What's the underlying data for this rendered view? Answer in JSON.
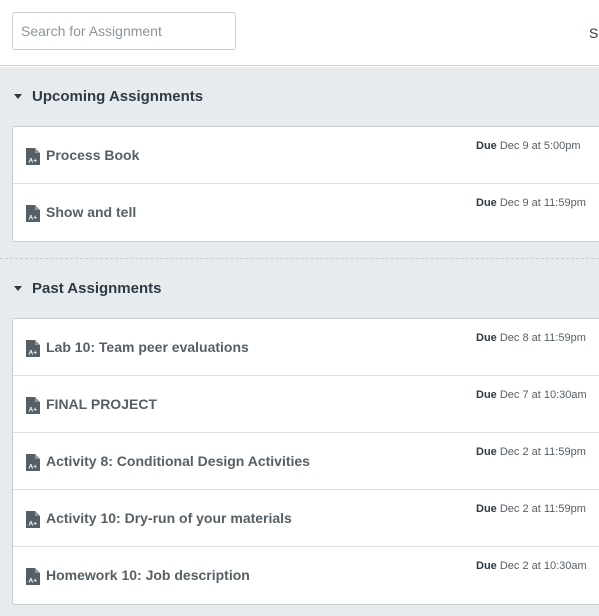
{
  "search": {
    "placeholder": "Search for Assignment",
    "value": ""
  },
  "top_right": {
    "text": "S"
  },
  "groups": [
    {
      "title": "Upcoming Assignments",
      "items": [
        {
          "title": "Process Book",
          "due_label": "Due",
          "due_date": "Dec 9 at 5:00pm"
        },
        {
          "title": "Show and tell",
          "due_label": "Due",
          "due_date": "Dec 9 at 11:59pm"
        }
      ]
    },
    {
      "title": "Past Assignments",
      "items": [
        {
          "title": "Lab 10: Team peer evaluations",
          "due_label": "Due",
          "due_date": "Dec 8 at 11:59pm"
        },
        {
          "title": "FINAL PROJECT",
          "due_label": "Due",
          "due_date": "Dec 7 at 10:30am"
        },
        {
          "title": "Activity 8: Conditional Design Activities",
          "due_label": "Due",
          "due_date": "Dec 2 at 11:59pm"
        },
        {
          "title": "Activity 10: Dry-run of your materials",
          "due_label": "Due",
          "due_date": "Dec 2 at 11:59pm"
        },
        {
          "title": "Homework 10: Job description",
          "due_label": "Due",
          "due_date": "Dec 2 at 10:30am"
        }
      ]
    }
  ],
  "icons": {
    "group_toggle": "caret-down-icon",
    "assignment": "assignment-document-icon"
  },
  "colors": {
    "background": "#e8ebee",
    "text": "#2d3b45",
    "muted": "#555f66",
    "border": "#c7cdd1"
  }
}
